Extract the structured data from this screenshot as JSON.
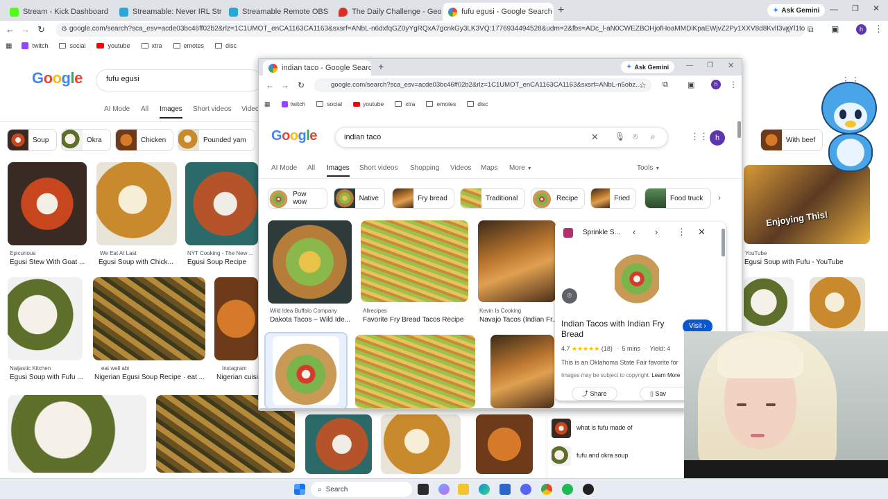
{
  "browser": {
    "tabs": [
      {
        "title": "Stream - Kick Dashboard",
        "color": "#53fc18"
      },
      {
        "title": "Streamable: Never IRL Stream W",
        "color": "#2aa7d8"
      },
      {
        "title": "Streamable Remote OBS",
        "color": "#2aa7d8"
      },
      {
        "title": "The Daily Challenge - GeoGues",
        "color": "#d93025"
      },
      {
        "title": "fufu egusi - Google Search",
        "color": "#4285f4"
      }
    ],
    "ask_gemini": "Ask Gemini",
    "url": "google.com/search?sca_esv=acde03bc46ff02b2&rlz=1C1UMOT_enCA1163CA1163&sxsrf=ANbL-n6dxfqGZ0yYgRQxA7gcnkGy3LK3VQ:1776934494528&udm=2&fbs=ADc_l-aN0CWEZBOHjofHoaMMDiKpaEWjvZ2Py1XXV8d8KvlI3vxYl1tojT_24H7Q4i...",
    "bookmarks": [
      "twitch",
      "social",
      "youtube",
      "xtra",
      "emotes",
      "disc"
    ],
    "avatar_letter": "h"
  },
  "main": {
    "search_query": "fufu egusi",
    "nav": [
      "AI Mode",
      "All",
      "Images",
      "Short videos",
      "Videos"
    ],
    "chips": [
      "Soup",
      "Okra",
      "Chicken",
      "Pounded yam"
    ],
    "right_chip": "With beef",
    "results_row1": [
      {
        "source": "Epicurious",
        "caption": "Egusi Stew With Goat ..."
      },
      {
        "source": "We Eat At Last",
        "caption": "Egusi Soup with Chick..."
      },
      {
        "source": "NYT Cooking - The New ...",
        "caption": "Egusi Soup Recipe"
      }
    ],
    "right_result": {
      "source": "YouTube",
      "caption": "Egusi Soup with Fufu - YouTube"
    },
    "results_row2": [
      {
        "source": "Naijastic Kitchen",
        "caption": "Egusi Soup with Fufu ..."
      },
      {
        "source": "eat well abi",
        "caption": "Nigerian Egusi Soup Recipe · eat ..."
      },
      {
        "source": "Instagram",
        "caption": "Nigerian cuisin"
      }
    ],
    "related": [
      "what is fufu made of",
      "fufu and okra soup"
    ],
    "thumb_overlay_text": "Enjoying This!"
  },
  "popup": {
    "tab_title": "indian taco - Google Search",
    "ask_gemini": "Ask Gemini",
    "url": "google.com/search?sca_esv=acde03bc46ff02b2&rlz=1C1UMOT_enCA1163CA1163&sxsrf=ANbL-n5obz...",
    "bookmarks": [
      "twitch",
      "social",
      "youtube",
      "xtra",
      "emotes",
      "disc"
    ],
    "search_query": "indian taco",
    "nav": [
      "AI Mode",
      "All",
      "Images",
      "Short videos",
      "Shopping",
      "Videos",
      "Maps",
      "More"
    ],
    "tools": "Tools",
    "chips": [
      "Pow wow",
      "Native",
      "Fry bread",
      "Traditional",
      "Recipe",
      "Fried",
      "Food truck"
    ],
    "results": [
      {
        "source": "Wild Idea Buffalo Company",
        "caption": "Dakota Tacos – Wild Ide..."
      },
      {
        "source": "Allrecipes",
        "caption": "Favorite Fry Bread Tacos Recipe"
      },
      {
        "source": "Kevin Is Cooking",
        "caption": "Navajo Tacos (Indian Fr..."
      }
    ],
    "panel": {
      "site": "Sprinkle S...",
      "title": "Indian Tacos with Indian Fry Bread",
      "visit": "Visit",
      "rating": "4.7",
      "stars": "★★★★★",
      "reviews": "(18)",
      "time": "5 mins",
      "yield": "Yield: 4",
      "description": "This is an Oklahoma State Fair favorite for",
      "copyright": "Images may be subject to copyright.",
      "learn_more": "Learn More",
      "share": "Share",
      "save": "Sav"
    }
  },
  "taskbar": {
    "search": "Search"
  }
}
